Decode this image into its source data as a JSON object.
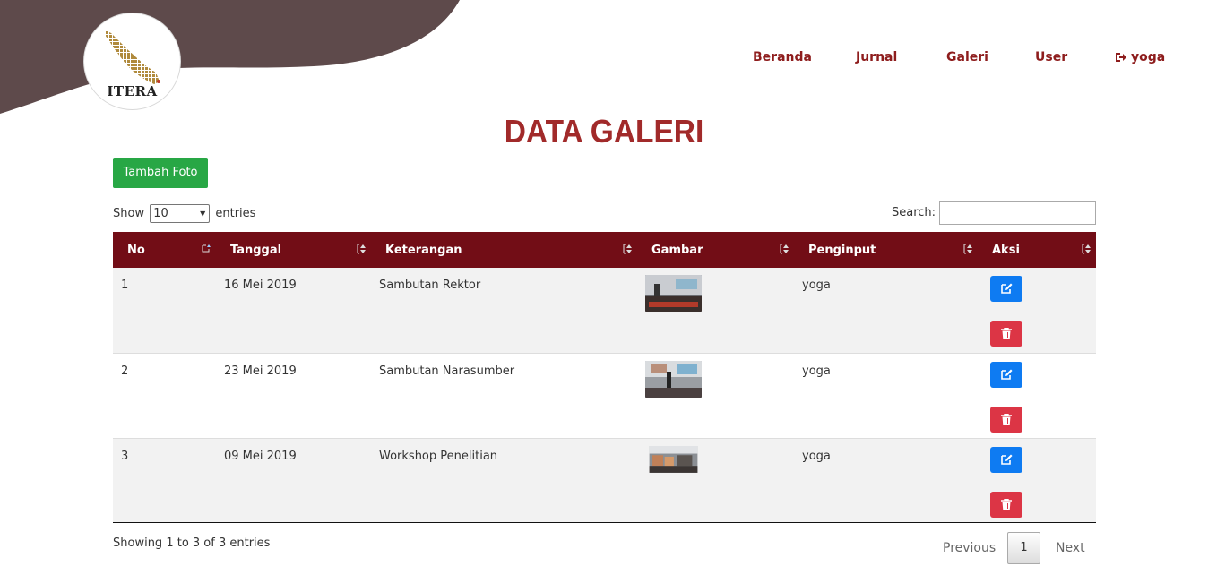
{
  "colors": {
    "header_bg": "#5e4a4b",
    "accent": "#a12a2a",
    "table_header": "#720d16",
    "add_button": "#28a745",
    "edit_button": "#0e7bf2",
    "delete_button": "#dc3545"
  },
  "brand": {
    "logo_text": "ITERA"
  },
  "nav": {
    "home": "Beranda",
    "journal": "Jurnal",
    "gallery": "Galeri",
    "user": "User",
    "account": "yoga",
    "account_icon": "sign-out-icon"
  },
  "page": {
    "title": "DATA GALERI"
  },
  "toolbar": {
    "add_label": "Tambah Foto"
  },
  "length": {
    "show_label": "Show",
    "value": "10",
    "entries_label": "entries"
  },
  "search": {
    "label": "Search:"
  },
  "table": {
    "headers": [
      "No",
      "Tanggal",
      "Keterangan",
      "Gambar",
      "Penginput",
      "Aksi"
    ],
    "rows": [
      {
        "no": "1",
        "date": "16 Mei 2019",
        "description": "Sambutan Rektor",
        "author": "yoga"
      },
      {
        "no": "2",
        "date": "23 Mei 2019",
        "description": "Sambutan Narasumber",
        "author": "yoga"
      },
      {
        "no": "3",
        "date": "09 Mei 2019",
        "description": "Workshop Penelitian",
        "author": "yoga"
      }
    ],
    "action_icons": [
      "edit-icon",
      "trash-icon"
    ]
  },
  "footer": {
    "info": "Showing 1 to 3 of 3 entries",
    "previous": "Previous",
    "page": "1",
    "next": "Next"
  }
}
